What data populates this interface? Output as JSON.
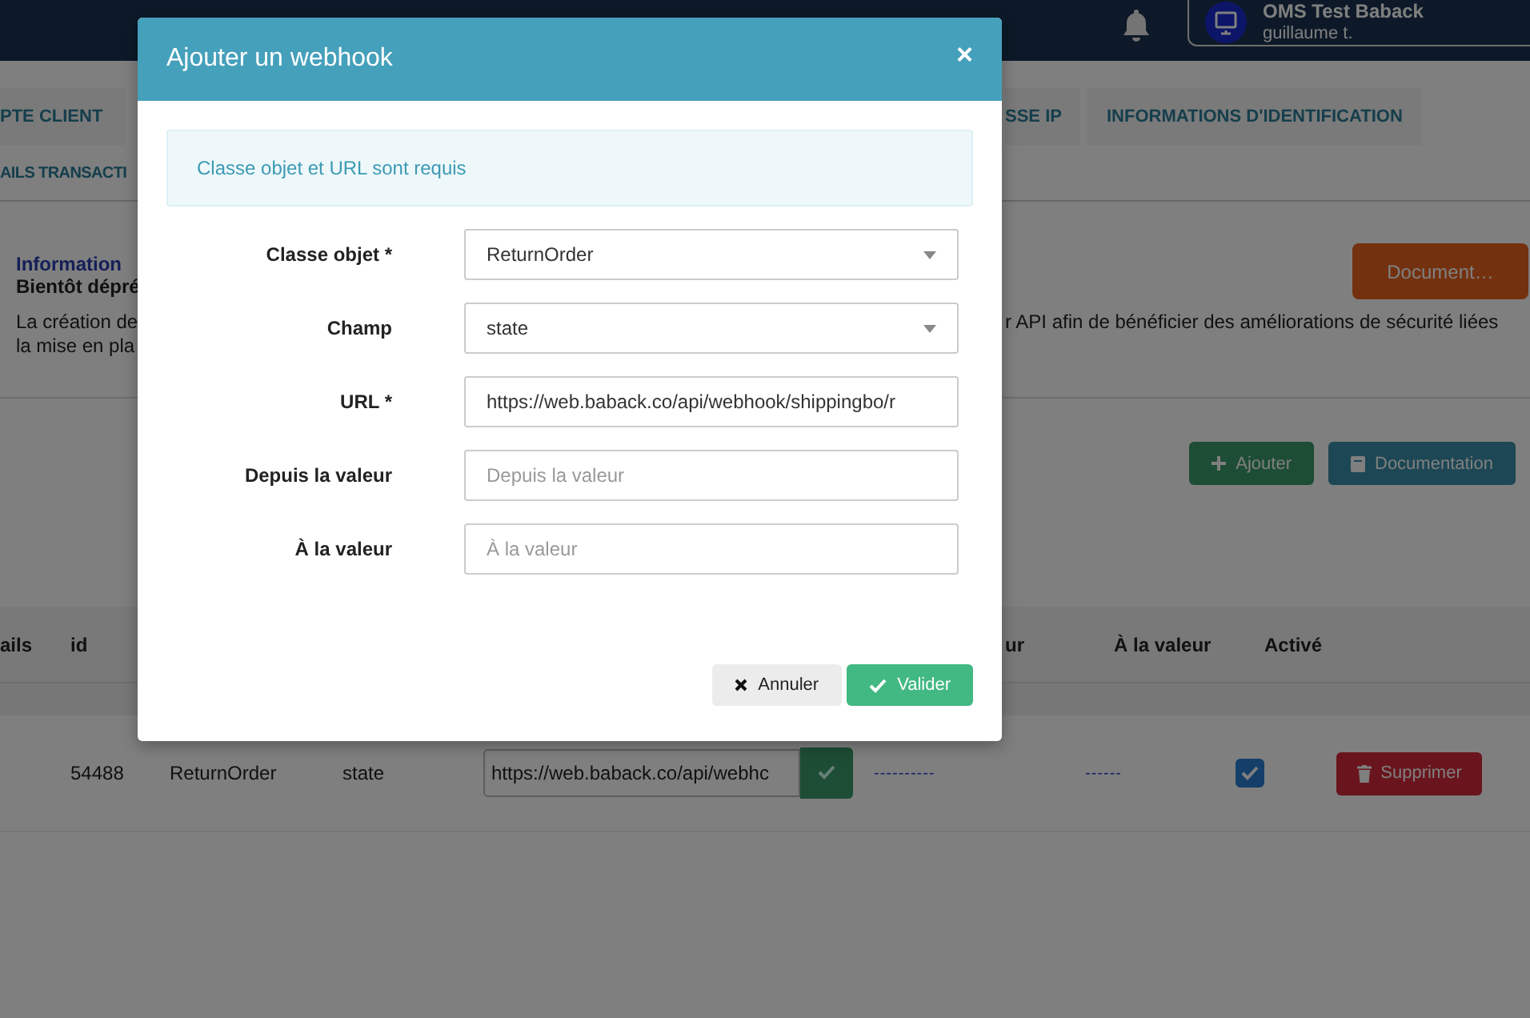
{
  "navbar": {
    "user": {
      "name": "OMS Test Baback",
      "subtitle": "guillaume t."
    }
  },
  "tabs": [
    {
      "label": "PTE CLIENT"
    },
    {
      "label": "SSE IP"
    },
    {
      "label": "INFORMATIONS D'IDENTIFICATION"
    },
    {
      "label": "AILS TRANSACTI"
    }
  ],
  "info": {
    "title": "Information",
    "subtitle": "Bientôt dépré",
    "text_left": [
      "La création de",
      "la mise en pla"
    ],
    "text_right": "r API afin de bénéficier des améliorations de sécurité liées",
    "button": "Document…"
  },
  "toolbar": {
    "buttons": [
      {
        "kind": "add",
        "label": "Ajouter"
      },
      {
        "kind": "docs",
        "label": "Documentation"
      }
    ]
  },
  "table": {
    "columns": [
      "ails",
      "id",
      "ur",
      "À la valeur",
      "Activé"
    ],
    "rows": [
      {
        "id": "54488",
        "class": "ReturnOrder",
        "field": "state",
        "url": "https://web.baback.co/api/webhc",
        "from": "----------",
        "to": "------",
        "active": true,
        "delete": "Supprimer"
      }
    ]
  },
  "modal": {
    "title": "Ajouter un webhook",
    "close": "×",
    "alert": "Classe objet et URL sont requis",
    "fields": [
      {
        "label": "Classe objet *",
        "kind": "select",
        "value": "ReturnOrder"
      },
      {
        "label": "Champ",
        "kind": "select",
        "value": "state"
      },
      {
        "label": "URL *",
        "kind": "text",
        "value": "https://web.baback.co/api/webhook/shippingbo/r"
      },
      {
        "label": "Depuis la valeur",
        "kind": "text",
        "placeholder": "Depuis la valeur"
      },
      {
        "label": "À la valeur",
        "kind": "text",
        "placeholder": "À la valeur"
      }
    ],
    "cancel": "Annuler",
    "submit": "Valider"
  }
}
